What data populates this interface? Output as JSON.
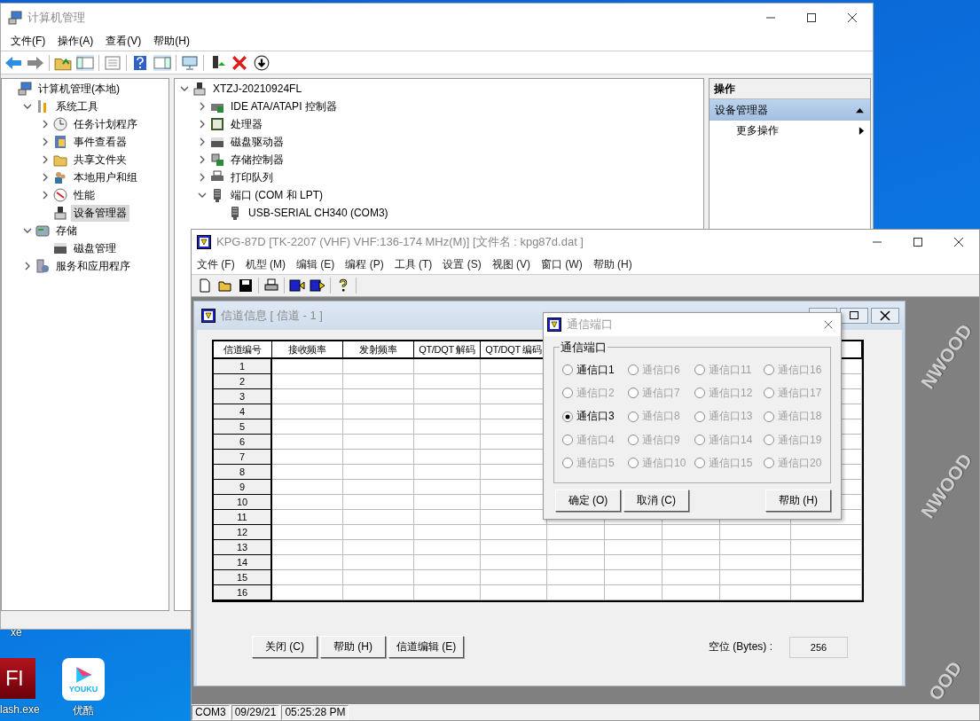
{
  "desktop": {
    "icons": [
      {
        "label": "xe"
      },
      {
        "label": "lash.exe",
        "logo": "Fl"
      },
      {
        "label": "优酷",
        "logo": "YOUKU"
      }
    ]
  },
  "computer_management": {
    "title": "计算机管理",
    "menu": [
      "文件(F)",
      "操作(A)",
      "查看(V)",
      "帮助(H)"
    ],
    "left_tree": [
      {
        "label": "计算机管理(本地)",
        "selected": false,
        "children": [
          {
            "label": "系统工具",
            "expanded": true,
            "selected": false,
            "children": [
              {
                "label": "任务计划程序",
                "expanded": false,
                "selected": false
              },
              {
                "label": "事件查看器",
                "expanded": false,
                "selected": false
              },
              {
                "label": "共享文件夹",
                "expanded": false,
                "selected": false
              },
              {
                "label": "本地用户和组",
                "expanded": false,
                "selected": false
              },
              {
                "label": "性能",
                "expanded": false,
                "selected": false
              },
              {
                "label": "设备管理器",
                "selected": true
              }
            ]
          },
          {
            "label": "存储",
            "expanded": true,
            "selected": false,
            "children": [
              {
                "label": "磁盘管理",
                "selected": false
              }
            ]
          },
          {
            "label": "服务和应用程序",
            "expanded": false,
            "selected": false
          }
        ]
      }
    ],
    "middle_tree": [
      {
        "label": "XTZJ-20210924FL",
        "expanded": true,
        "children": [
          {
            "label": "IDE ATA/ATAPI 控制器",
            "expanded": false
          },
          {
            "label": "处理器",
            "expanded": false
          },
          {
            "label": "磁盘驱动器",
            "expanded": false
          },
          {
            "label": "存储控制器",
            "expanded": false
          },
          {
            "label": "打印队列",
            "expanded": false
          },
          {
            "label": "端口 (COM 和 LPT)",
            "expanded": true,
            "children": [
              {
                "label": "USB-SERIAL CH340 (COM3)"
              }
            ]
          }
        ]
      }
    ],
    "actions": {
      "header": "操作",
      "section": {
        "label": "设备管理器",
        "expanded": true
      },
      "items": [
        {
          "label": "更多操作"
        }
      ]
    }
  },
  "kpg": {
    "title": "KPG-87D [TK-2207 (VHF) VHF:136-174 MHz(M)] [文件名 : kpg87d.dat ]",
    "menu": [
      "文件 (F)",
      "机型 (M)",
      "编辑 (E)",
      "编程 (P)",
      "工具 (T)",
      "设置 (S)",
      "视图 (V)",
      "窗口 (W)",
      "帮助 (H)"
    ],
    "background_logo": [
      "NWOOD",
      "NWOOD",
      "OOD"
    ],
    "channel_window": {
      "title": "信道信息 [ 信道 - 1 ]",
      "columns": [
        "信道编号",
        "接收频率",
        "发射频率",
        "QT/DQT 解码",
        "QT/DQT 编码"
      ],
      "rows": [
        "1",
        "2",
        "3",
        "4",
        "5",
        "6",
        "7",
        "8",
        "9",
        "10",
        "11",
        "12",
        "13",
        "14",
        "15",
        "16"
      ],
      "buttons": [
        "关闭 (C)",
        "帮助 (H)",
        "信道编辑 (E)"
      ],
      "free_label": "空位 (Bytes) :",
      "free_value": "256"
    },
    "port_dialog": {
      "title": "通信端口",
      "group": "通信端口",
      "ports": [
        {
          "label": "通信口1",
          "selected": false,
          "disabled": false
        },
        {
          "label": "通信口2",
          "selected": false,
          "disabled": true
        },
        {
          "label": "通信口3",
          "selected": true,
          "disabled": false
        },
        {
          "label": "通信口4",
          "selected": false,
          "disabled": true
        },
        {
          "label": "通信口5",
          "selected": false,
          "disabled": true
        },
        {
          "label": "通信口6",
          "selected": false,
          "disabled": true
        },
        {
          "label": "通信口7",
          "selected": false,
          "disabled": true
        },
        {
          "label": "通信口8",
          "selected": false,
          "disabled": true
        },
        {
          "label": "通信口9",
          "selected": false,
          "disabled": true
        },
        {
          "label": "通信口10",
          "selected": false,
          "disabled": true
        },
        {
          "label": "通信口11",
          "selected": false,
          "disabled": true
        },
        {
          "label": "通信口12",
          "selected": false,
          "disabled": true
        },
        {
          "label": "通信口13",
          "selected": false,
          "disabled": true
        },
        {
          "label": "通信口14",
          "selected": false,
          "disabled": true
        },
        {
          "label": "通信口15",
          "selected": false,
          "disabled": true
        },
        {
          "label": "通信口16",
          "selected": false,
          "disabled": true
        },
        {
          "label": "通信口17",
          "selected": false,
          "disabled": true
        },
        {
          "label": "通信口18",
          "selected": false,
          "disabled": true
        },
        {
          "label": "通信口19",
          "selected": false,
          "disabled": true
        },
        {
          "label": "通信口20",
          "selected": false,
          "disabled": true
        }
      ],
      "buttons": [
        "确定 (O)",
        "取消 (C)",
        "帮助 (H)"
      ]
    },
    "status_bar": [
      "COM3",
      "09/29/21",
      "05:25:28 PM"
    ]
  }
}
